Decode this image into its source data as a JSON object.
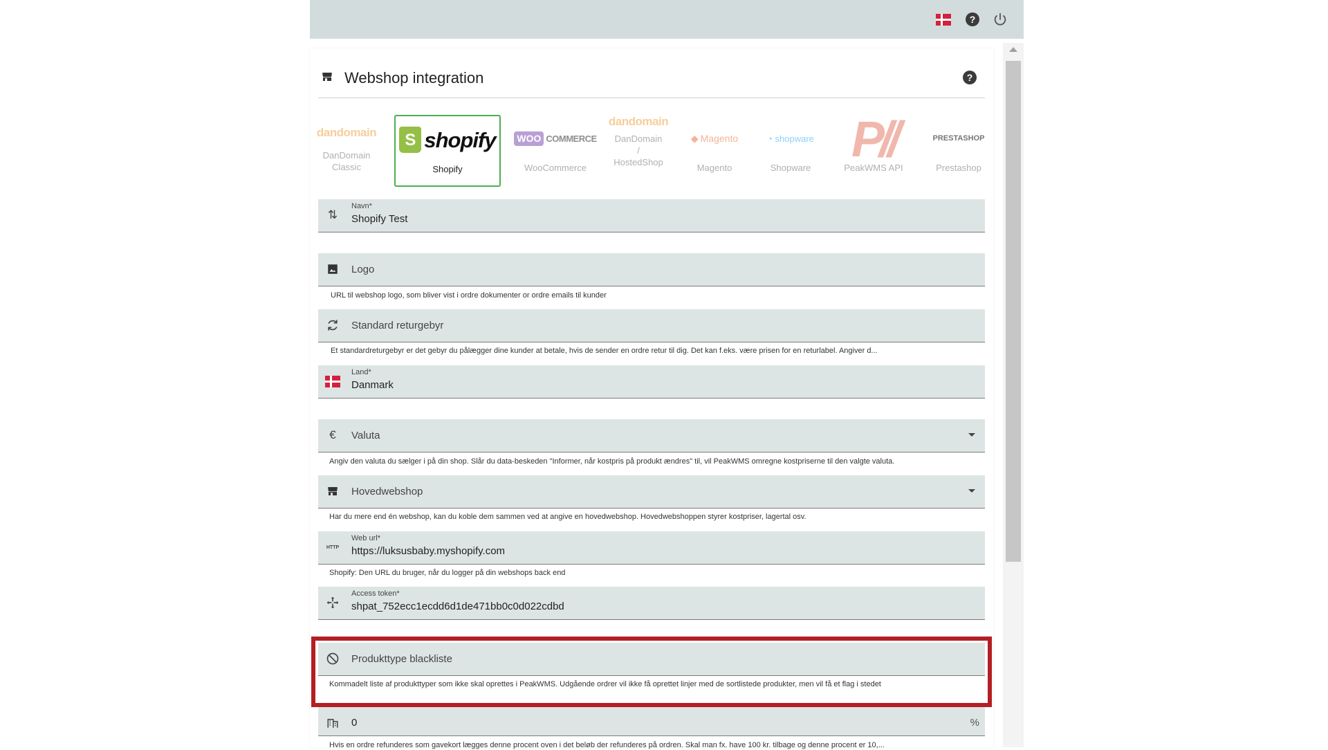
{
  "topbar": {
    "flag_icon": "denmark-flag-icon",
    "help_icon": "help-circle-icon",
    "power_icon": "power-icon"
  },
  "header": {
    "title": "Webshop integration",
    "help_glyph": "?"
  },
  "platforms": [
    {
      "logo": "dandomain",
      "label": "DanDomain\nClassic"
    },
    {
      "logo": "shopify",
      "label": "Shopify",
      "selected": true
    },
    {
      "logo": "woocommerce",
      "label": "WooCommerce"
    },
    {
      "logo": "dandomain",
      "label": "DanDomain\n/\nHostedShop"
    },
    {
      "logo": "magento",
      "label": "Magento"
    },
    {
      "logo": "shopware",
      "label": "Shopware"
    },
    {
      "logo": "peakwms",
      "label": "PeakWMS API"
    },
    {
      "logo": "prestashop",
      "label": "Prestashop"
    }
  ],
  "logos": {
    "dandomain": "dandomain",
    "shopify_bag": "S",
    "shopify_word": "shopify",
    "woo": "WOO",
    "commerce": "COMMERCE",
    "magento": "Magento",
    "shopware": "shopware",
    "peakwms": "P//",
    "prestashop": "PRESTASHOP"
  },
  "fields": {
    "name": {
      "label": "Navn*",
      "value": "Shopify Test"
    },
    "logo": {
      "placeholder": "Logo",
      "hint": "URL til webshop logo, som bliver vist i ordre dokumenter or ordre emails til kunder"
    },
    "return_fee": {
      "placeholder": "Standard returgebyr",
      "hint": "Et standardreturgebyr er det gebyr du pålægger dine kunder at betale, hvis de sender en ordre retur til dig. Det kan f.eks. være prisen for en returlabel. Angiver d..."
    },
    "country": {
      "label": "Land*",
      "value": "Danmark"
    },
    "currency": {
      "icon_glyph": "€",
      "placeholder": "Valuta",
      "hint": "Angiv den valuta du sælger i på din shop. Slår du data-beskeden \"Informer, når kostpris på produkt ændres\" til, vil PeakWMS omregne kostpriserne til den valgte valuta."
    },
    "main_webshop": {
      "placeholder": "Hovedwebshop",
      "hint": "Har du mere end én webshop, kan du koble dem sammen ved at angive en hovedwebshop. Hovedwebshoppen styrer kostpriser, lagertal osv."
    },
    "web_url": {
      "icon_glyph": "HTTP",
      "label": "Web url*",
      "value": "https://luksusbaby.myshopify.com",
      "hint": "Shopify: Den URL du bruger, når du logger på din webshops back end"
    },
    "access_token": {
      "label": "Access token*",
      "value": "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"
    },
    "blacklist": {
      "placeholder": "Produkttype blackliste",
      "hint": "Kommadelt liste af produkttyper som ikke skal oprettes i PeakWMS. Udgående ordrer vil ikke få oprettet linjer med de sortlistede produkter, men vil få et flag i stedet"
    },
    "giftcard": {
      "value": "0",
      "suffix": "%",
      "hint": "Hvis en ordre refunderes som gavekort lægges denne procent oven i det beløb der refunderes på ordren. Skal man fx. have 100 kr. tilbage og denne procent er 10,..."
    }
  },
  "colors": {
    "highlight": "#b21f24",
    "selected_border": "#4caf50",
    "field_bg": "#dde4e4",
    "topbar_bg": "#d3dcdc"
  }
}
